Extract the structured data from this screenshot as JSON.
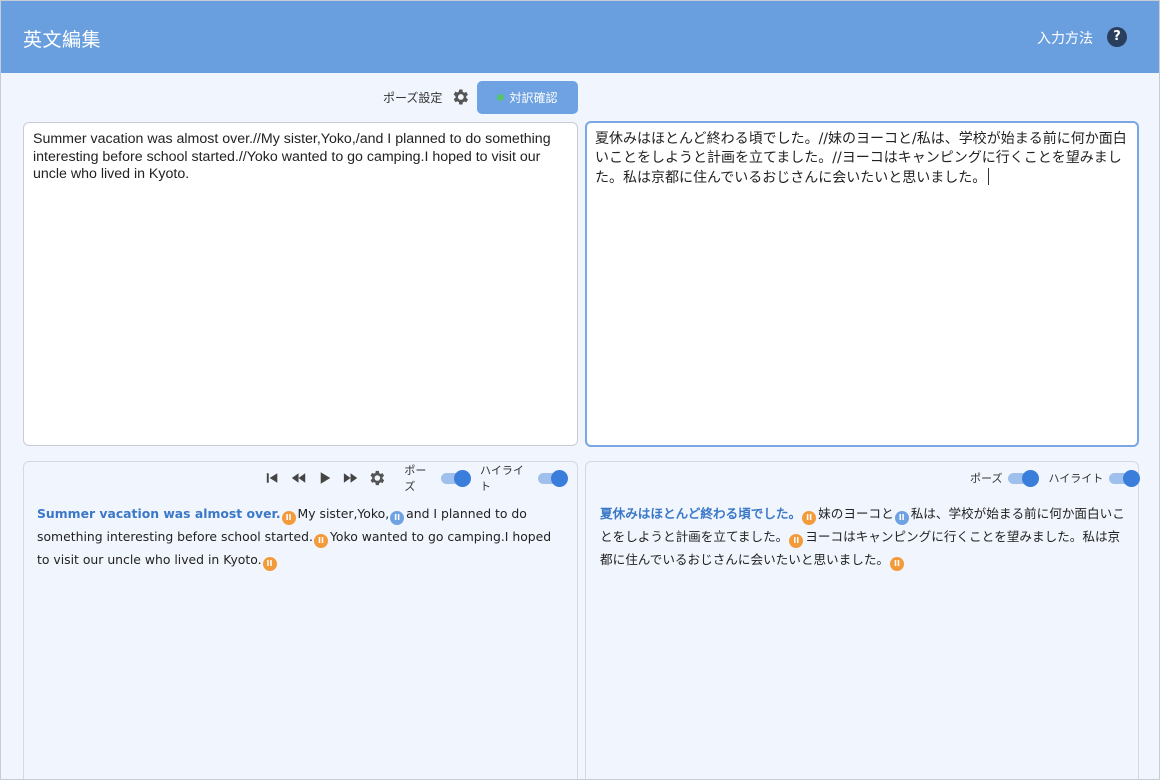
{
  "header": {
    "title": "英文編集",
    "input_method_label": "入力方法",
    "help_icon": "?"
  },
  "toolbar": {
    "pause_settings_label": "ポーズ設定",
    "confirm_button_label": "対訳確認",
    "confirm_status_color": "#56c46a"
  },
  "editor_left": {
    "text": "Summer vacation was almost over.//My sister,Yoko,/and I planned to do something interesting before school started.//Yoko wanted to go camping.I hoped to visit our uncle who lived in Kyoto."
  },
  "editor_right": {
    "text": "夏休みはほとんど終わる頃でした。//妹のヨーコと/私は、学校が始まる前に何か面白いことをしようと計画を立てました。//ヨーコはキャンピングに行くことを望みました。私は京都に住んでいるおじさんに会いたいと思いました。"
  },
  "preview_left": {
    "toggle_pause_label": "ポーズ",
    "toggle_highlight_label": "ハイライト",
    "pause_on": true,
    "highlight_on": true,
    "segments": {
      "s1": "Summer vacation was almost over.",
      "s2": "My sister,Yoko,",
      "s3": "and I planned to do something interesting before school started.",
      "s4": "Yoko wanted to go camping.I hoped to visit our uncle who lived in Kyoto."
    }
  },
  "preview_right": {
    "toggle_pause_label": "ポーズ",
    "toggle_highlight_label": "ハイライト",
    "pause_on": true,
    "highlight_on": true,
    "segments": {
      "s1": "夏休みはほとんど終わる頃でした。",
      "s2": "妹のヨーコと",
      "s3": "私は、学校が始まる前に何か面白いことをしようと計画を立てました。",
      "s4": "ヨーコはキャンピングに行くことを望みました。私は京都に住んでいるおじさんに会いたいと思いました。"
    }
  },
  "pause_marker_glyph": "II",
  "colors": {
    "header_bg": "#6a9fdf",
    "accent_button": "#6ea2e2",
    "highlight_text": "#3a78c8",
    "long_pause_marker": "#f39a3a",
    "short_pause_marker": "#6ea2e2"
  }
}
